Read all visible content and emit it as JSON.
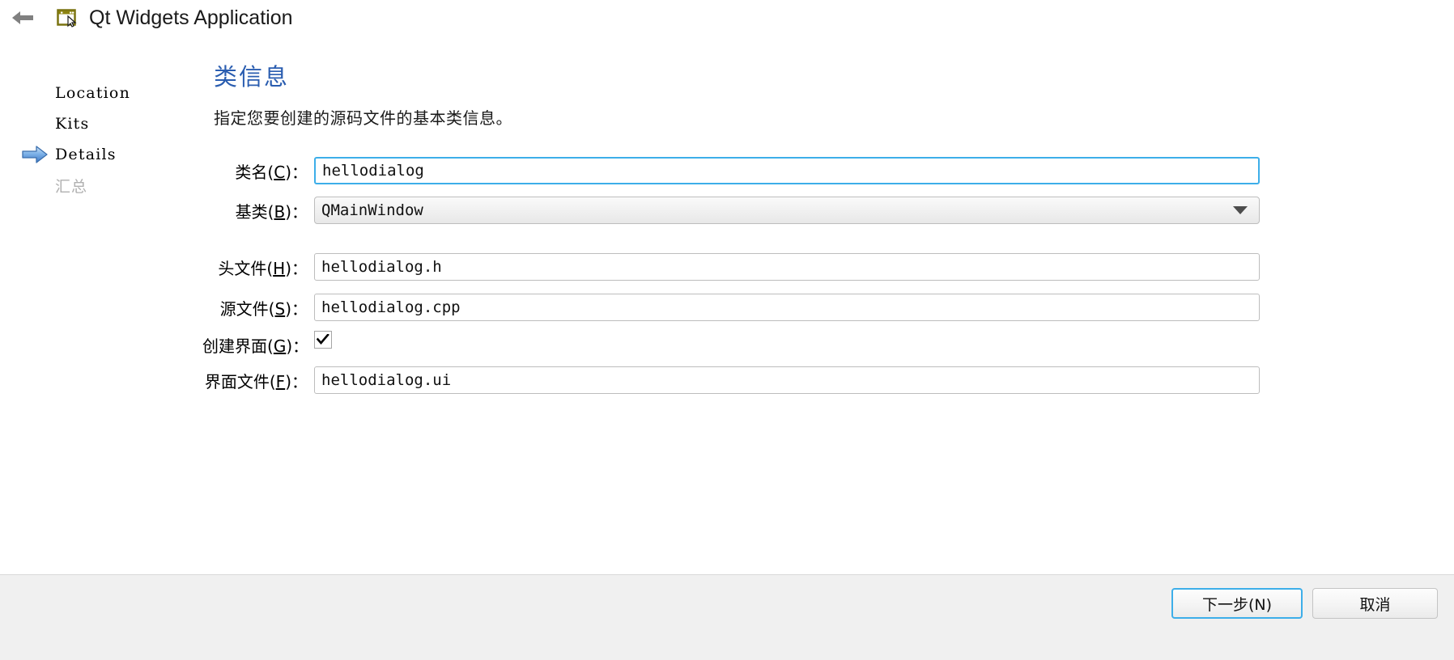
{
  "header": {
    "back_icon": "back-arrow-icon",
    "app_icon": "qt-widgets-application-icon",
    "title": "Qt Widgets Application"
  },
  "sidebar": {
    "items": [
      {
        "label": "Location",
        "state": "done",
        "marker": "none"
      },
      {
        "label": "Kits",
        "state": "done",
        "marker": "none"
      },
      {
        "label": "Details",
        "state": "current",
        "marker": "blue-arrow-icon"
      },
      {
        "label": "汇总",
        "state": "disabled",
        "marker": "none"
      }
    ]
  },
  "main": {
    "title": "类信息",
    "description": "指定您要创建的源码文件的基本类信息。",
    "title_color": "#2a5db0",
    "fields": [
      {
        "name": "class-name",
        "label_prefix": "类名(",
        "label_mnemonic": "C",
        "label_suffix": ")：",
        "type": "text",
        "value": "hellodialog",
        "placeholder": "",
        "focused": true
      },
      {
        "name": "base-class",
        "label_prefix": "基类(",
        "label_mnemonic": "B",
        "label_suffix": ")：",
        "type": "combo",
        "value": "QMainWindow",
        "focused": false
      },
      {
        "name": "header-file",
        "label_prefix": "头文件(",
        "label_mnemonic": "H",
        "label_suffix": ")：",
        "type": "text",
        "value": "hellodialog.h",
        "placeholder": "",
        "focused": false
      },
      {
        "name": "source-file",
        "label_prefix": "源文件(",
        "label_mnemonic": "S",
        "label_suffix": ")：",
        "type": "text",
        "value": "hellodialog.cpp",
        "placeholder": "",
        "focused": false
      },
      {
        "name": "generate-form",
        "label_prefix": "创建界面(",
        "label_mnemonic": "G",
        "label_suffix": ")：",
        "type": "checkbox",
        "checked": true
      },
      {
        "name": "form-file",
        "label_prefix": "界面文件(",
        "label_mnemonic": "F",
        "label_suffix": ")：",
        "type": "text",
        "value": "hellodialog.ui",
        "placeholder": "",
        "focused": false
      }
    ]
  },
  "footer": {
    "next_button": "下一步(N)",
    "cancel_button": "取消",
    "default_button_accent": "#3daee9"
  }
}
